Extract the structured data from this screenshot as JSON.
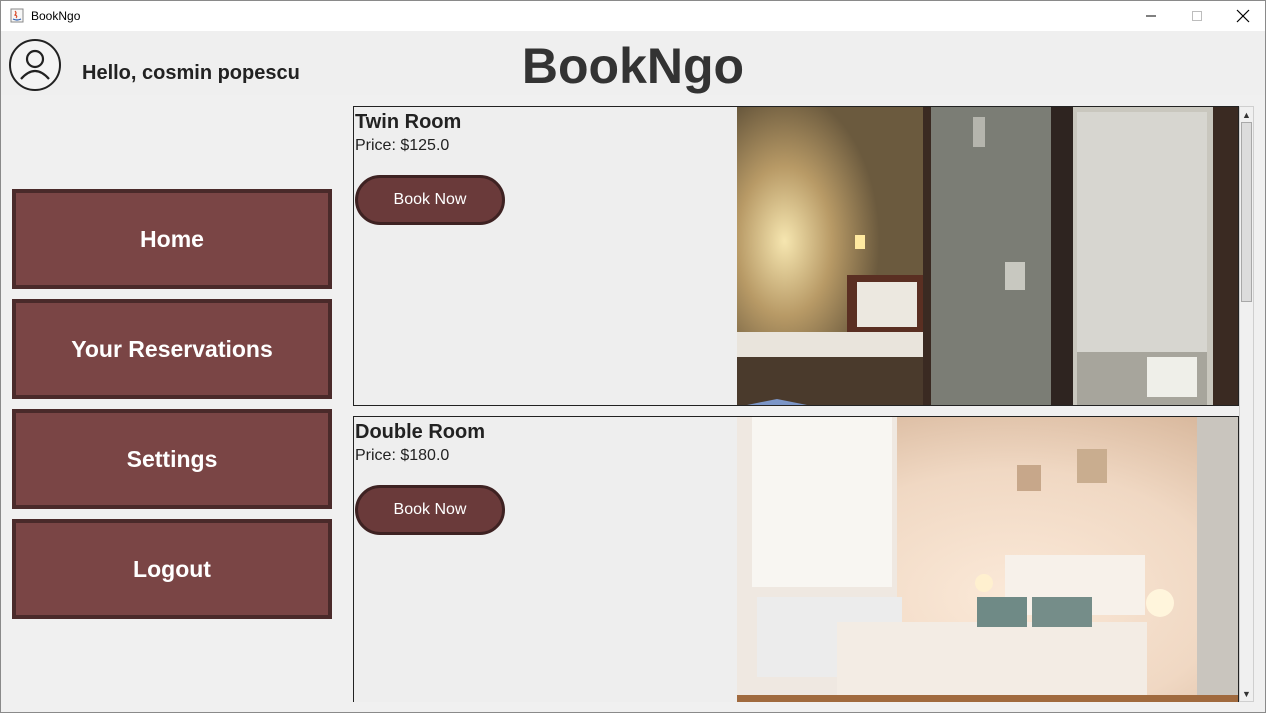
{
  "window": {
    "title": "BookNgo",
    "icons": [
      "java-app-icon",
      "minimize-icon",
      "maximize-icon",
      "close-icon"
    ]
  },
  "header": {
    "greeting": "Hello, cosmin popescu",
    "app_title": "BookNgo",
    "avatar_icon": "user-avatar-icon"
  },
  "sidebar": {
    "items": [
      {
        "label": "Home"
      },
      {
        "label": "Your Reservations"
      },
      {
        "label": "Settings"
      },
      {
        "label": "Logout"
      }
    ]
  },
  "rooms": [
    {
      "name": "Twin Room",
      "price": "Price: $125.0",
      "button": "Book Now",
      "photo": "twin-room-photo"
    },
    {
      "name": "Double Room",
      "price": "Price: $180.0",
      "button": "Book Now",
      "photo": "double-room-photo"
    }
  ],
  "colors": {
    "accent": "#7a4545",
    "accent_border": "#4a2a2a",
    "book_button": "#6a3a3a",
    "background": "#f0f0f0"
  }
}
